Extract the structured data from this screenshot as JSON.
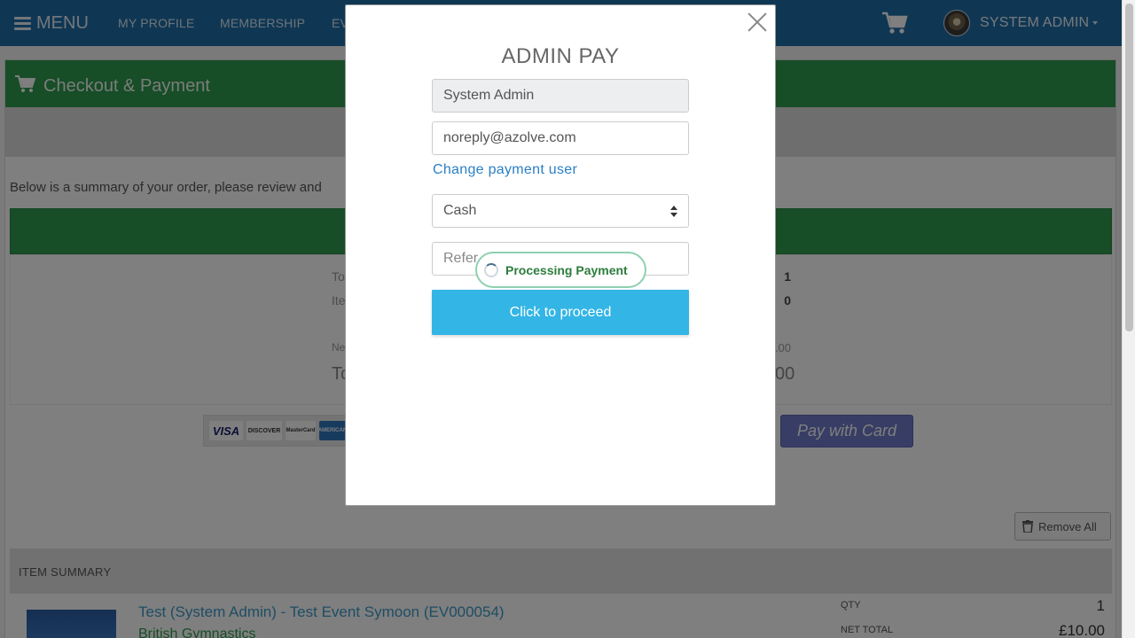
{
  "nav": {
    "menu_label": "MENU",
    "links": [
      "MY PROFILE",
      "MEMBERSHIP",
      "EV"
    ],
    "user_label": "SYSTEM ADMIN"
  },
  "page": {
    "title": "Checkout & Payment",
    "summary_text": "Below is a summary of your order, please review and",
    "totals_left": [
      "To",
      "Ite",
      "Ne",
      "To"
    ],
    "totals_right": [
      "1",
      "0",
      ".00",
      "00"
    ],
    "pay_with_card": "Pay with Card",
    "remove_all": "Remove All",
    "item_summary_header": "ITEM SUMMARY",
    "item": {
      "title": "Test (System Admin) - Test Event Symoon (EV000054)",
      "org": "British Gymnastics",
      "qty_label": "QTY",
      "qty": "1",
      "net_label": "NET TOTAL",
      "net": "£10.00"
    },
    "card_logos": [
      "VISA",
      "DISCOVER",
      "MasterCard",
      "AMERICAN"
    ]
  },
  "modal": {
    "title": "ADMIN PAY",
    "name_value": "System Admin",
    "email_value": "noreply@azolve.com",
    "change_link": "Change payment user",
    "payment_method": "Cash",
    "reference_placeholder": "Refer",
    "processing": "Processing Payment",
    "proceed": "Click to proceed"
  },
  "colors": {
    "nav": "#1e6fa8",
    "green": "#2e9a4e",
    "proceed": "#33b5e5",
    "card_button": "#6f7bc9"
  }
}
